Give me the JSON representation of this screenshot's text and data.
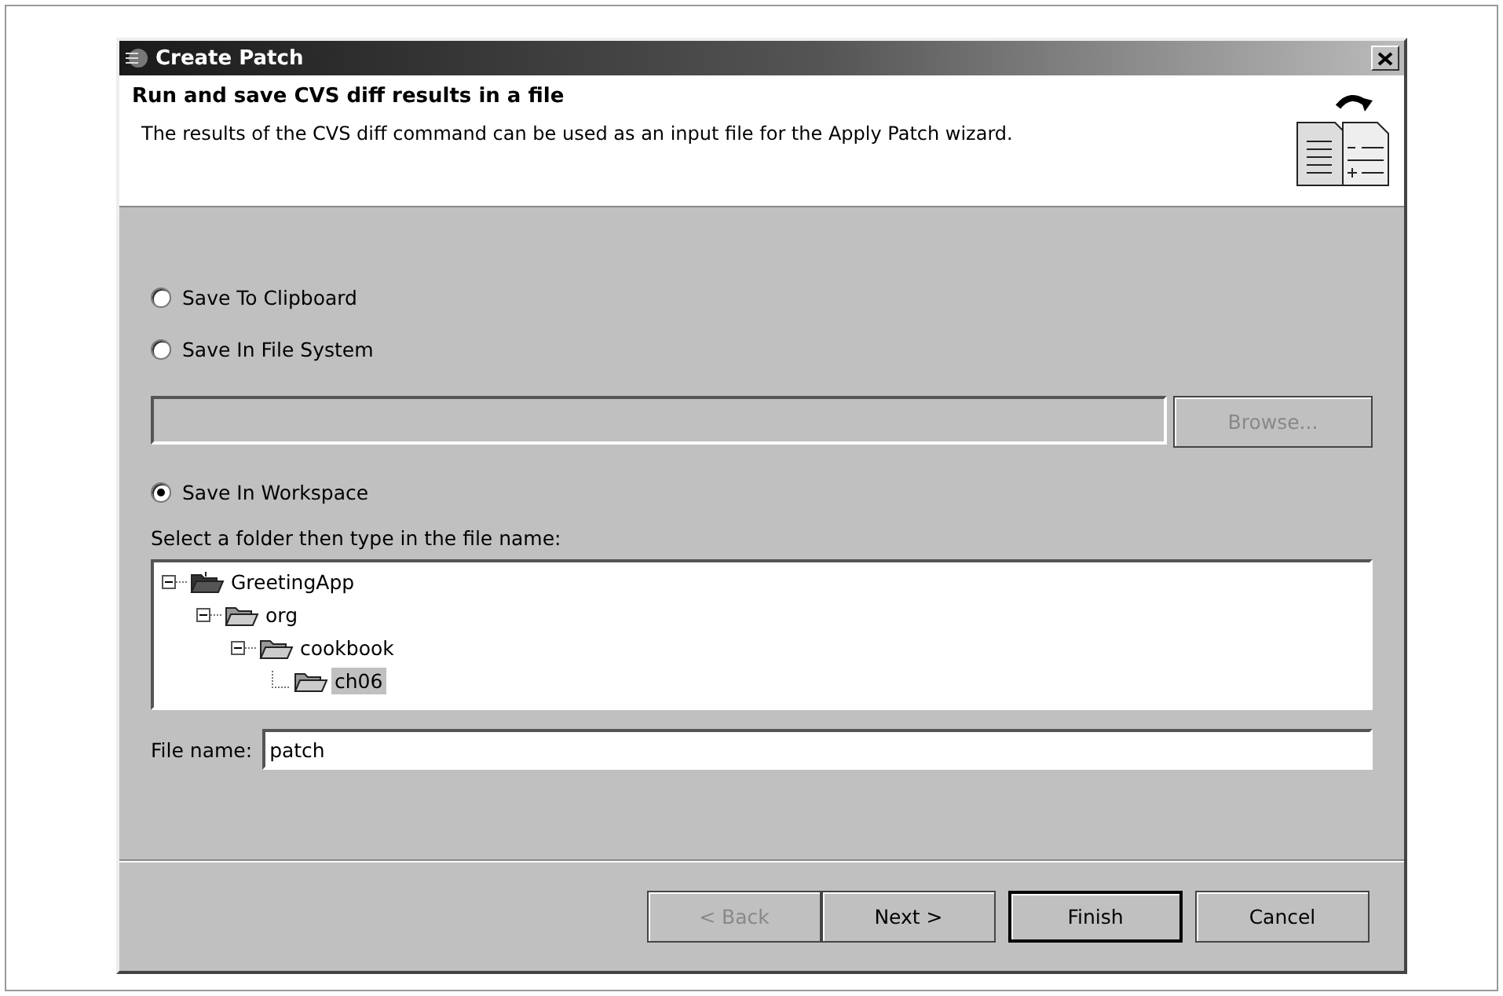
{
  "window": {
    "title": "Create Patch"
  },
  "header": {
    "title": "Run and save CVS diff results in a file",
    "description": "The results of the CVS diff command can be used as an input file for the Apply Patch wizard."
  },
  "options": [
    {
      "label": "Save To Clipboard",
      "selected": false
    },
    {
      "label": "Save In File System",
      "selected": false
    }
  ],
  "path_field": {
    "disabled": true
  },
  "browse_button": {
    "label": "Browse...",
    "disabled": true
  },
  "workspace_option": {
    "label": "Save In Workspace",
    "selected": true
  },
  "tree_label": "Select a folder then type in the file name:",
  "tree": [
    {
      "label": "GreetingApp",
      "kind": "project",
      "expanded": true,
      "selected": false,
      "children": [
        {
          "label": "org",
          "kind": "folder",
          "expanded": true,
          "selected": false,
          "children": [
            {
              "label": "cookbook",
              "kind": "folder",
              "expanded": true,
              "selected": false,
              "children": [
                {
                  "label": "ch06",
                  "kind": "folder",
                  "selected": true
                }
              ]
            }
          ]
        }
      ]
    }
  ],
  "file_name": {
    "label": "File name:",
    "value": "patch"
  },
  "buttons": [
    {
      "label": "< Back",
      "disabled": true,
      "default": false
    },
    {
      "label": "Next >",
      "disabled": false,
      "default": false
    },
    {
      "label": "Finish",
      "disabled": false,
      "default": true
    },
    {
      "label": "Cancel",
      "disabled": false,
      "default": false
    }
  ]
}
